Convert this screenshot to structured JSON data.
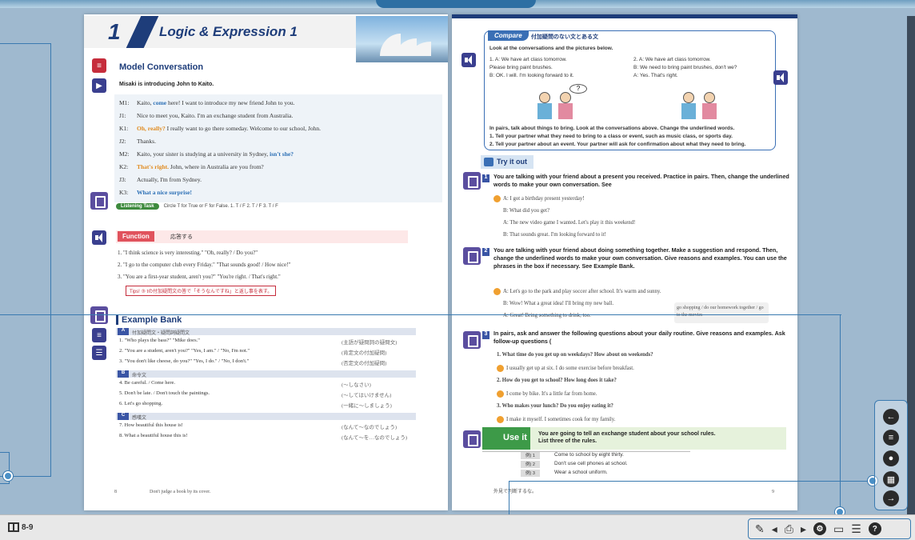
{
  "lesson": {
    "number": "1",
    "title": "Logic & Expression 1"
  },
  "model_conversation": {
    "heading": "Model Conversation",
    "intro": "Misaki is introducing John to Kaito.",
    "lines": [
      {
        "sp": "M1:",
        "pre": "Kaito, ",
        "hl": "come",
        "hl_color": "blue",
        "post": " here! I want to introduce my new friend John to you."
      },
      {
        "sp": "J1:",
        "pre": "Nice to meet you, Kaito. I'm an exchange student from Australia.",
        "hl": "",
        "hl_color": "",
        "post": ""
      },
      {
        "sp": "K1:",
        "pre": "",
        "hl": "Oh, really?",
        "hl_color": "orange",
        "post": " I really want to go there someday. Welcome to our school, John."
      },
      {
        "sp": "J2:",
        "pre": "Thanks.",
        "hl": "",
        "hl_color": "",
        "post": ""
      },
      {
        "sp": "M2:",
        "pre": "Kaito, your sister is studying at a university in Sydney, ",
        "hl": "isn't she?",
        "hl_color": "blue",
        "post": ""
      },
      {
        "sp": "K2:",
        "pre": "",
        "hl": "That's right.",
        "hl_color": "orange",
        "post": " John, where in Australia are you from?"
      },
      {
        "sp": "J3:",
        "pre": "Actually, I'm from Sydney.",
        "hl": "",
        "hl_color": "",
        "post": ""
      },
      {
        "sp": "K3:",
        "pre": "",
        "hl": "What a nice surprise!",
        "hl_color": "blue",
        "post": ""
      }
    ],
    "listening_label": "Listening Task",
    "listening_text": "Circle T for True or F for False.   1. T / F   2. T / F   3. T / F"
  },
  "function": {
    "label": "Function",
    "jp": "応答する",
    "lines": [
      "1. \"I think science is very interesting.\" \"Oh, really? / Do you?\"",
      "2. \"I go to the computer club every Friday.\" \"That sounds good! / How nice!\"",
      "3. \"You are a first-year student, aren't you?\" \"You're right. / That's right.\""
    ],
    "tips": "Tips! ③ tの付加疑問文の答で「そうなんですね」と返し事を表す。"
  },
  "example_bank": {
    "heading": "Example Bank",
    "sections": [
      {
        "tag": "A",
        "jp": "付加疑問文・疑問詞疑問文",
        "items": [
          {
            "en": "1. \"Who plays the bass?\" \"Mike does.\"",
            "jp": "(主語が疑問詞の疑問文)"
          },
          {
            "en": "2. \"You are a student, aren't you?\" \"Yes, I am.\" / \"No, I'm not.\"",
            "jp": "(肯定文の付加疑問)"
          },
          {
            "en": "3. \"You don't like cheese, do you?\" \"Yes, I do.\" / \"No, I don't.\"",
            "jp": "(否定文の付加疑問)"
          }
        ]
      },
      {
        "tag": "B",
        "jp": "命令文",
        "items": [
          {
            "en": "4. Be careful. / Come here.",
            "jp": "(〜しなさい)"
          },
          {
            "en": "5. Don't be late. / Don't touch the paintings.",
            "jp": "(〜してはいけません)"
          },
          {
            "en": "6. Let's go shopping.",
            "jp": "(一緒に〜しましょう)"
          }
        ]
      },
      {
        "tag": "C",
        "jp": "感嘆文",
        "items": [
          {
            "en": "7. How beautiful this house is!",
            "jp": "(なんて〜なのでしょう)"
          },
          {
            "en": "8. What a beautiful house this is!",
            "jp": "(なんて〜を…なのでしょう)"
          }
        ]
      }
    ],
    "footer_left_num": "8",
    "footer_left": "Don't judge a book by its cover.",
    "footer_right": "外見で判断するな。",
    "footer_right_num": "9"
  },
  "compare": {
    "tag": "Compare",
    "jp": "付加疑問のない文とある文",
    "instr": "Look at the conversations and the pictures below.",
    "left": [
      "1. A: We have art class tomorrow.",
      "   Please bring paint brushes.",
      "   B: OK. I will. I'm looking forward to it."
    ],
    "right": [
      "2. A: We have art class tomorrow.",
      "   B: We need to bring paint brushes, don't we?",
      "   A: Yes. That's right."
    ],
    "task": [
      "In pairs, talk about things to bring. Look at the conversations above. Change the underlined words.",
      "1. Tell your partner what they need to bring to a class or event, such as music class, or sports day.",
      "2. Tell your partner about an event. Your partner will ask for confirmation about what they need to bring."
    ]
  },
  "try_it_out": {
    "label": "Try it out",
    "q1": "You are talking with your friend about a present you received. Practice in pairs. Then, change the underlined words to make your own conversation. See",
    "q1_lines": [
      "A: I got a birthday present yesterday!",
      "B: What did you get?",
      "A: The new video game I wanted. Let's play it this weekend!",
      "B: That sounds great. I'm looking forward to it!"
    ],
    "q2": "You are talking with your friend about doing something together. Make a suggestion and respond. Then, change the underlined words to make your own conversation. Give reasons and examples. You can use the phrases in the box if necessary. See Example Bank.",
    "q2_lines": [
      "A: Let's go to the park and play soccer after school. It's warm and sunny.",
      "B: Wow! What a great idea! I'll bring my new ball.",
      "A: Great! Bring something to drink, too."
    ],
    "phrase_box": "go shopping / do our homework together / go to the movies",
    "q3": "In pairs, ask and answer the following questions about your daily routine. Give reasons and examples. Ask follow-up questions (",
    "q3_lines": [
      "1. What time do you get up on weekdays?  How about on weekends?",
      "I usually get up at six. I do some exercise before breakfast.",
      "2. How do you get to school?  How long does it take?",
      "I come by bike. It's a little far from home.",
      "3. Who makes your lunch?  Do you enjoy eating it?",
      "I make it myself. I sometimes cook for my family."
    ]
  },
  "use_it": {
    "label": "Use it",
    "text1": "You are going to tell an exchange student about your school rules.",
    "text2": "List three of the rules.",
    "rules": [
      {
        "code": "例) 1",
        "text": "Come to school by eight thirty."
      },
      {
        "code": "例) 2",
        "text": "Don't use cell phones at school."
      },
      {
        "code": "例) 3",
        "text": "Wear a school uniform."
      }
    ]
  },
  "bottom_bar": {
    "page_indicator": "8-9"
  },
  "colors": {
    "navy": "#1e3d7a",
    "accent_blue": "#3a7ab0",
    "function_red": "#e0525c",
    "use_it_green": "#3d9a48"
  }
}
